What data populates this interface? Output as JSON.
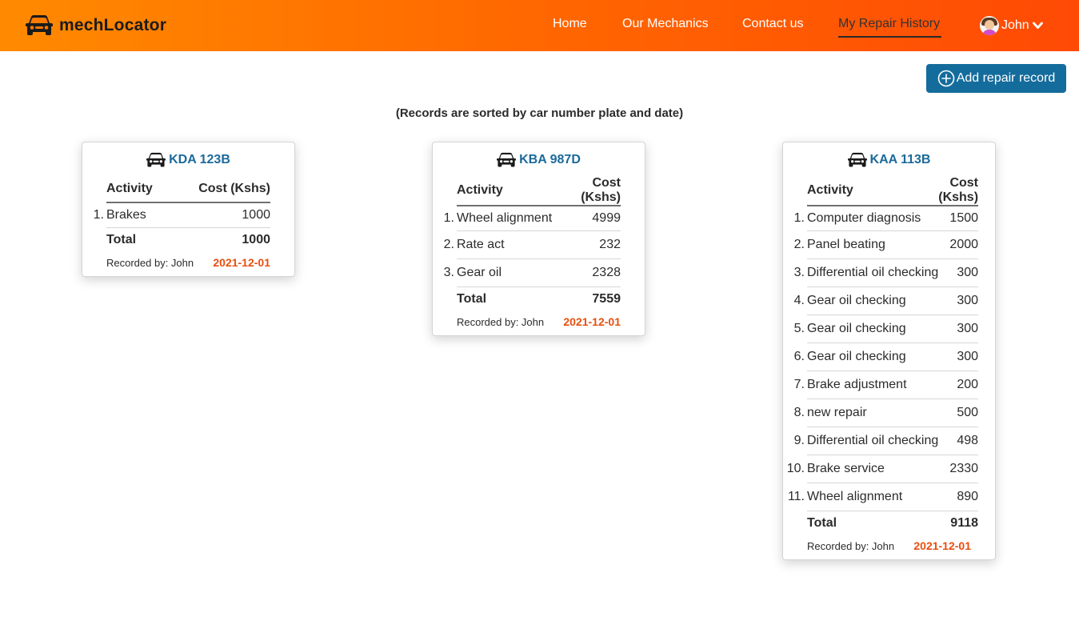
{
  "brand": {
    "name": "mechLocator",
    "logo_icon": "car-icon"
  },
  "nav": {
    "home": "Home",
    "mechanics": "Our Mechanics",
    "contact": "Contact us",
    "history": "My Repair History",
    "user": "John"
  },
  "actions": {
    "add_record": "Add repair record"
  },
  "sort_note": "(Records are sorted by car number plate and date)",
  "table_headers": {
    "activity": "Activity",
    "cost": "Cost (Kshs)"
  },
  "total_label": "Total",
  "colors": {
    "navbar_start": "#ff8a00",
    "navbar_end": "#ff4a05",
    "accent_blue": "#146c9c",
    "date_orange": "#e84e0f"
  },
  "cards": [
    {
      "plate": "KDA 123B",
      "items": [
        {
          "n": "1.",
          "activity": "Brakes",
          "cost": "1000"
        }
      ],
      "total": "1000",
      "recorded_by": "Recorded by: John",
      "date": "2021-12-01"
    },
    {
      "plate": "KBA 987D",
      "items": [
        {
          "n": "1.",
          "activity": "Wheel alignment",
          "cost": "4999"
        },
        {
          "n": "2.",
          "activity": "Rate act",
          "cost": "232"
        },
        {
          "n": "3.",
          "activity": "Gear oil",
          "cost": "2328"
        }
      ],
      "total": "7559",
      "recorded_by": "Recorded by: John",
      "date": "2021-12-01"
    },
    {
      "plate": "KAA 113B",
      "items": [
        {
          "n": "1.",
          "activity": "Computer diagnosis",
          "cost": "1500"
        },
        {
          "n": "2.",
          "activity": "Panel beating",
          "cost": "2000"
        },
        {
          "n": "3.",
          "activity": "Differential oil checking",
          "cost": "300"
        },
        {
          "n": "4.",
          "activity": "Gear oil checking",
          "cost": "300"
        },
        {
          "n": "5.",
          "activity": "Gear oil checking",
          "cost": "300"
        },
        {
          "n": "6.",
          "activity": "Gear oil checking",
          "cost": "300"
        },
        {
          "n": "7.",
          "activity": "Brake adjustment",
          "cost": "200"
        },
        {
          "n": "8.",
          "activity": "new repair",
          "cost": "500"
        },
        {
          "n": "9.",
          "activity": "Differential oil checking",
          "cost": "498"
        },
        {
          "n": "10.",
          "activity": "Brake service",
          "cost": "2330"
        },
        {
          "n": "11.",
          "activity": "Wheel alignment",
          "cost": "890"
        }
      ],
      "total": "9118",
      "recorded_by": "Recorded by: John",
      "date": "2021-12-01"
    }
  ]
}
